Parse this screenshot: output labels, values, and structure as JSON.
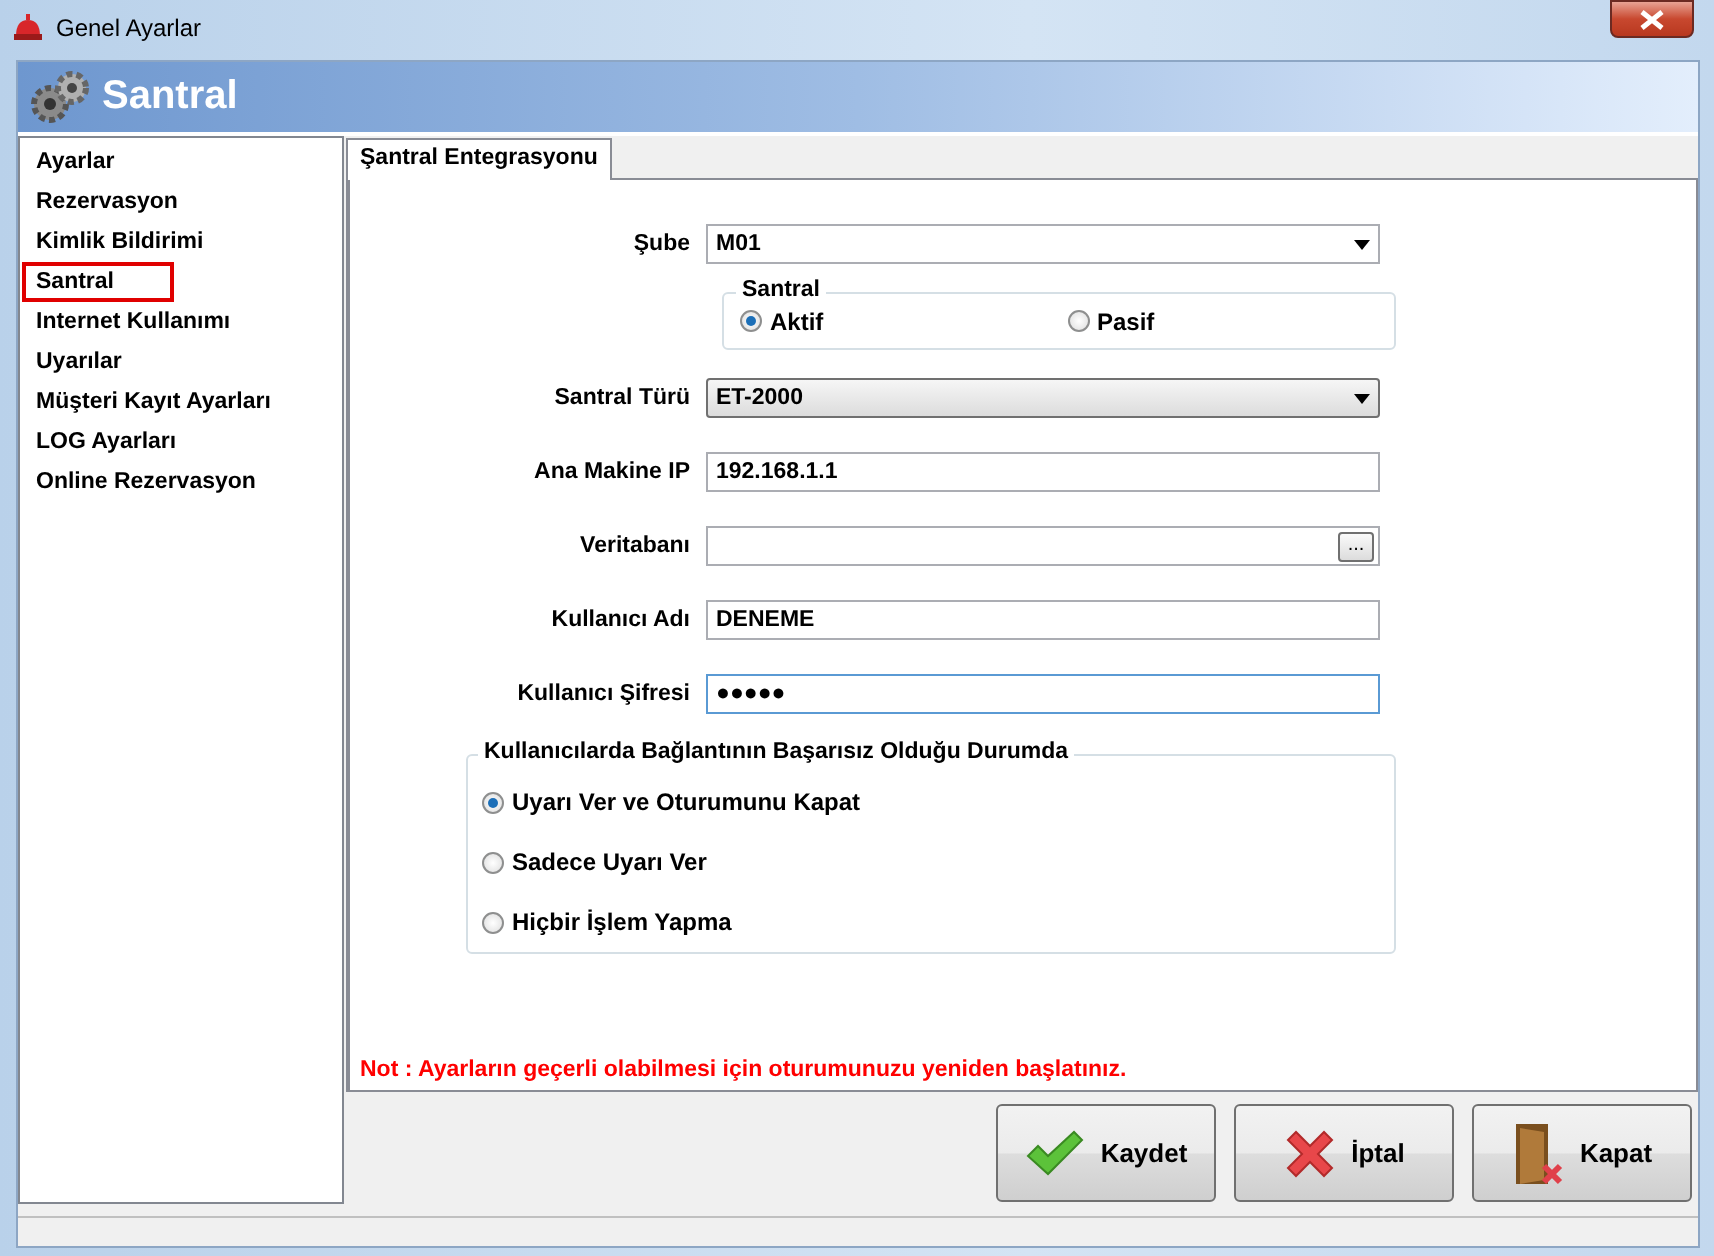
{
  "window": {
    "title": "Genel Ayarlar"
  },
  "header": {
    "title": "Santral"
  },
  "sidebar": {
    "items": [
      {
        "label": "Ayarlar",
        "selected": false
      },
      {
        "label": "Rezervasyon",
        "selected": false
      },
      {
        "label": "Kimlik Bildirimi",
        "selected": false
      },
      {
        "label": "Santral",
        "selected": true
      },
      {
        "label": "Internet Kullanımı",
        "selected": false
      },
      {
        "label": "Uyarılar",
        "selected": false
      },
      {
        "label": "Müşteri Kayıt Ayarları",
        "selected": false
      },
      {
        "label": "LOG Ayarları",
        "selected": false
      },
      {
        "label": "Online Rezervasyon",
        "selected": false
      }
    ]
  },
  "tabs": [
    {
      "label": "Şantral Entegrasyonu",
      "selected": true
    }
  ],
  "form": {
    "fields": [
      {
        "kind": "select",
        "label": "Şube",
        "value": "M01"
      },
      {
        "kind": "radios",
        "legend": "Santral",
        "options": [
          {
            "label": "Aktif",
            "selected": true
          },
          {
            "label": "Pasif",
            "selected": false
          }
        ]
      },
      {
        "kind": "dropdown",
        "label": "Santral Türü",
        "value": "ET-2000"
      },
      {
        "kind": "text",
        "label": "Ana Makine IP",
        "value": "192.168.1.1"
      },
      {
        "kind": "browse",
        "label": "Veritabanı",
        "button": "..."
      },
      {
        "kind": "text",
        "label": "Kullanıcı Adı",
        "value": "DENEME"
      },
      {
        "kind": "password",
        "label": "Kullanıcı Şifresi",
        "value": "●●●●●"
      }
    ]
  },
  "failure_group": {
    "legend": "Kullanıcılarda Bağlantının Başarısız Olduğu Durumda",
    "options": [
      {
        "label": "Uyarı Ver ve Oturumunu Kapat",
        "selected": true
      },
      {
        "label": "Sadece Uyarı Ver",
        "selected": false
      },
      {
        "label": "Hiçbir İşlem Yapma",
        "selected": false
      }
    ]
  },
  "note": "Not : Ayarların geçerli olabilmesi için oturumunuzu yeniden başlatınız.",
  "buttons": [
    {
      "kind": "save",
      "label": "Kaydet"
    },
    {
      "kind": "cancel",
      "label": "İptal"
    },
    {
      "kind": "close",
      "label": "Kapat"
    }
  ]
}
